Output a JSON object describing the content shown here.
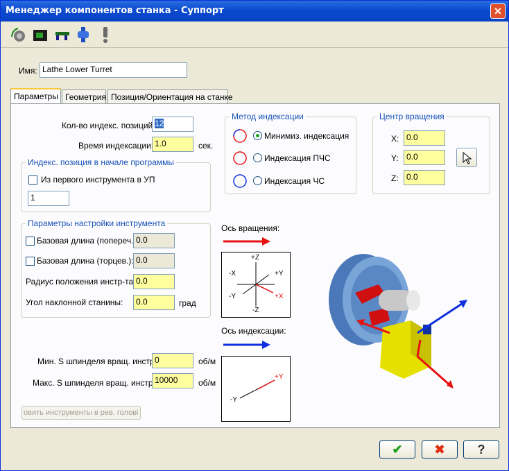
{
  "window": {
    "title": "Менеджер компонентов станка - Суппорт",
    "close": "✕"
  },
  "toolbar": {
    "icons": [
      "chuck-icon",
      "turret-icon",
      "holder-icon",
      "spindle-icon",
      "warning-icon"
    ]
  },
  "name": {
    "label": "Имя:",
    "value": "Lathe Lower Turret"
  },
  "tabs": [
    "Параметры",
    "Геометрия",
    "Позиция/Ориентация на станке"
  ],
  "params": {
    "index_positions_label": "Кол-во индекс. позиций:",
    "index_positions_value": "12",
    "index_time_label": "Время индексации:",
    "index_time_value": "1.0",
    "index_time_unit": "сек.",
    "start_group_title": "Индекс. позиция в начале программы",
    "first_tool_label": "Из первого инструмента в УП",
    "start_position_value": "1",
    "tool_group_title": "Параметры настройки инструмента",
    "base_len_trans_label": "Базовая длина (попереч.):",
    "base_len_trans_value": "0.0",
    "base_len_face_label": "Базовая длина (торцев.):",
    "base_len_face_value": "0.0",
    "radius_label": "Радиус положения инстр-та:",
    "radius_value": "0.0",
    "bed_angle_label": "Угол наклонной станины:",
    "bed_angle_value": "0.0",
    "bed_angle_unit": "град",
    "min_s_label": "Мин. S шпинделя вращ. инстр.:",
    "min_s_value": "0",
    "min_s_unit": "об/м",
    "max_s_label": "Макс. S шпинделя вращ. инстр.:",
    "max_s_value": "10000",
    "max_s_unit": "об/м",
    "apply_button": "овить инструменты в рев. голові"
  },
  "index_method": {
    "title": "Метод индексации",
    "options": [
      "Минимиз. индексация",
      "Индексация ПЧС",
      "Индексация ЧС"
    ],
    "selected": 0
  },
  "rotation_center": {
    "title": "Центр вращения",
    "x_label": "X:",
    "x_value": "0.0",
    "y_label": "Y:",
    "y_value": "0.0",
    "z_label": "Z:",
    "z_value": "0.0"
  },
  "rotation_axis": {
    "label": "Ось вращения:",
    "plus_z": "+Z",
    "minus_z": "-Z",
    "minus_x": "-X",
    "plus_y": "+Y",
    "minus_y": "-Y",
    "plus_x": "+X"
  },
  "index_axis": {
    "label": "Ось индексации:",
    "plus_y": "+Y",
    "minus_y": "-Y"
  },
  "colors": {
    "red": "#e81010",
    "blue": "#1030e0",
    "yellow_field": "#ffffa0"
  },
  "buttons": {
    "ok": "✔",
    "cancel": "✖",
    "help": "?"
  }
}
